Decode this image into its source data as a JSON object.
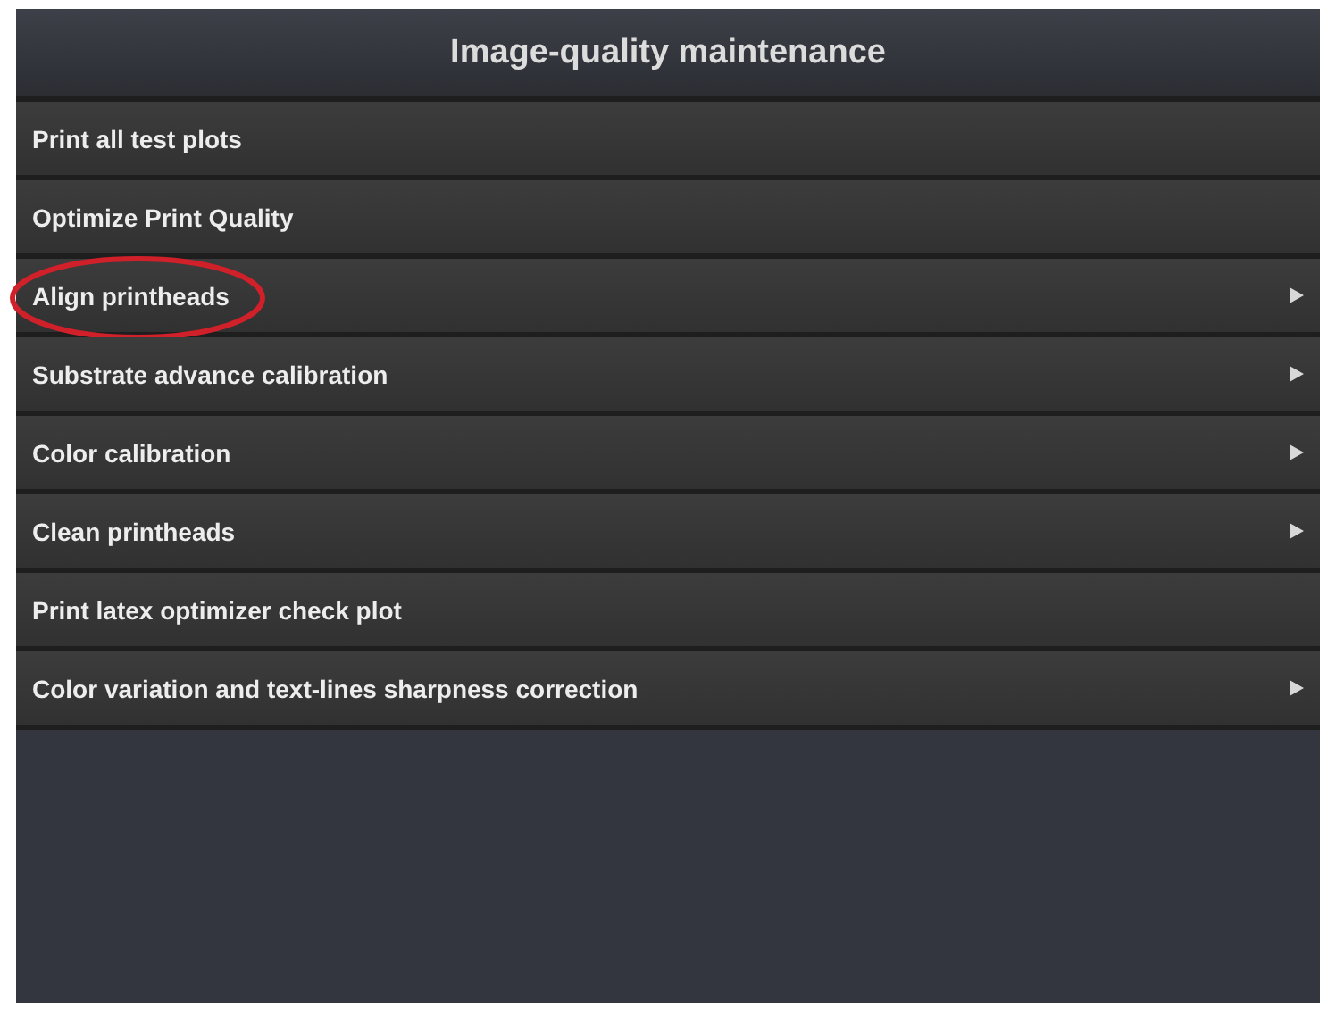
{
  "window": {
    "title": "Image-quality maintenance"
  },
  "menu": {
    "items": [
      {
        "label": "Print all test plots",
        "has_submenu": false,
        "highlighted": false
      },
      {
        "label": "Optimize Print Quality",
        "has_submenu": false,
        "highlighted": false
      },
      {
        "label": "Align printheads",
        "has_submenu": true,
        "highlighted": true
      },
      {
        "label": "Substrate advance calibration",
        "has_submenu": true,
        "highlighted": false
      },
      {
        "label": "Color calibration",
        "has_submenu": true,
        "highlighted": false
      },
      {
        "label": "Clean printheads",
        "has_submenu": true,
        "highlighted": false
      },
      {
        "label": "Print latex optimizer check plot",
        "has_submenu": false,
        "highlighted": false
      },
      {
        "label": "Color variation and text-lines sharpness correction",
        "has_submenu": true,
        "highlighted": false
      }
    ]
  }
}
